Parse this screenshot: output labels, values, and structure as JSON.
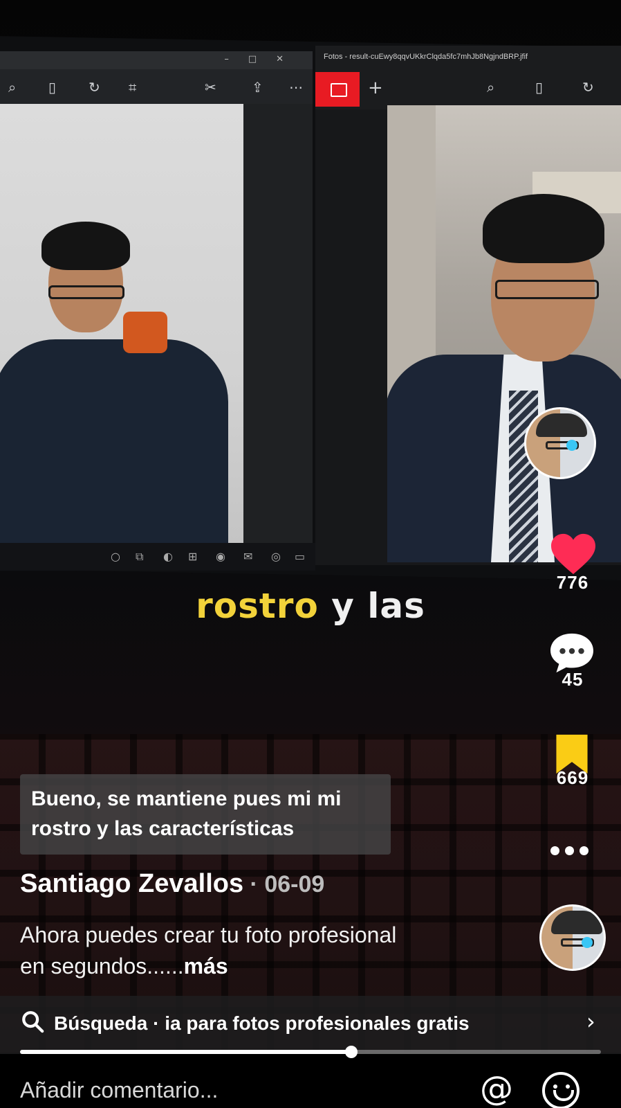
{
  "video": {
    "caption_word1": "rostro",
    "caption_word2": "y las",
    "right_window_title": "Fotos - result-cuEwy8qqvUKkrClqda5fc7mhJb8NgjndBRP.jfif"
  },
  "actions": {
    "likes": "776",
    "comments": "45",
    "saves": "669",
    "like_color": "#fe2c55",
    "save_color": "#facc15"
  },
  "subtitle": {
    "line1": "Bueno, se mantiene pues mi mi",
    "line2": "rostro y las características"
  },
  "post": {
    "author": "Santiago Zevallos",
    "separator": " · ",
    "date": "06-09",
    "description_line1": "Ahora puedes crear tu foto profesional",
    "description_line2": "en segundos......",
    "more": "más"
  },
  "search": {
    "label": "Búsqueda · ia para fotos profesionales gratis"
  },
  "playback": {
    "progress_fraction": 0.57
  },
  "comment": {
    "placeholder": "Añadir comentario..."
  },
  "icons": {
    "like": "heart-icon",
    "comment": "comment-icon",
    "save": "bookmark-icon",
    "more": "more-icon",
    "search": "search-icon",
    "chevron": "chevron-right-icon",
    "mention": "at-icon",
    "emoji": "emoji-icon"
  }
}
